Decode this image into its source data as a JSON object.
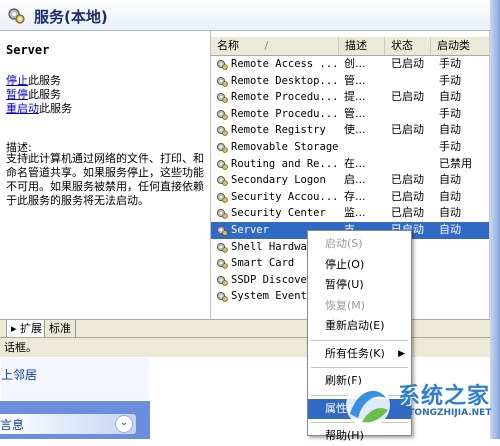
{
  "window": {
    "title": "服务(本地)",
    "icon": "gears-icon"
  },
  "left": {
    "service_name": "Server",
    "actions": [
      {
        "link": "停止",
        "suffix": "此服务"
      },
      {
        "link": "暂停",
        "suffix": "此服务"
      },
      {
        "link": "重启动",
        "suffix": "此服务"
      }
    ],
    "desc_title": "描述:",
    "desc_body": "支持此计算机通过网络的文件、打印、和命名管道共享。如果服务停止，这些功能不可用。如果服务被禁用，任何直接依赖于此服务的服务将无法启动。"
  },
  "list": {
    "columns": [
      "名称",
      "描述",
      "状态",
      "启动类"
    ],
    "rows": [
      {
        "name": "Remote Access ...",
        "desc": "创...",
        "status": "已启动",
        "start": "手动"
      },
      {
        "name": "Remote Desktop...",
        "desc": "管...",
        "status": "",
        "start": "手动"
      },
      {
        "name": "Remote Procedu...",
        "desc": "提...",
        "status": "已启动",
        "start": "自动"
      },
      {
        "name": "Remote Procedu...",
        "desc": "管...",
        "status": "",
        "start": "手动"
      },
      {
        "name": "Remote Registry",
        "desc": "使...",
        "status": "已启动",
        "start": "自动"
      },
      {
        "name": "Removable Storage",
        "desc": "",
        "status": "",
        "start": "手动"
      },
      {
        "name": "Routing and Re...",
        "desc": "在...",
        "status": "",
        "start": "已禁用"
      },
      {
        "name": "Secondary Logon",
        "desc": "启...",
        "status": "已启动",
        "start": "自动"
      },
      {
        "name": "Security Accou...",
        "desc": "存...",
        "status": "已启动",
        "start": "自动"
      },
      {
        "name": "Security Center",
        "desc": "监...",
        "status": "已启动",
        "start": "自动"
      },
      {
        "name": "Server",
        "desc": "支...",
        "status": "已启动",
        "start": "自动",
        "selected": true
      },
      {
        "name": "Shell Hardware...",
        "desc": "",
        "status": "",
        "start": ""
      },
      {
        "name": "Smart Card",
        "desc": "",
        "status": "",
        "start": ""
      },
      {
        "name": "SSDP Discover...",
        "desc": "",
        "status": "",
        "start": ""
      },
      {
        "name": "System Event ...",
        "desc": "",
        "status": "",
        "start": ""
      }
    ]
  },
  "tabs": [
    "扩展",
    "标准"
  ],
  "status_text": "话框。",
  "taskpane": {
    "link": "上邻居",
    "group": "言息"
  },
  "context_menu": [
    {
      "label": "启动(S)",
      "disabled": true
    },
    {
      "label": "停止(O)"
    },
    {
      "label": "暂停(U)"
    },
    {
      "label": "恢复(M)",
      "disabled": true
    },
    {
      "label": "重新启动(E)"
    },
    {
      "separator": true
    },
    {
      "label": "所有任务(K)",
      "submenu": true
    },
    {
      "separator": true
    },
    {
      "label": "刷新(F)"
    },
    {
      "separator": true
    },
    {
      "label": "属性(R)",
      "highlighted": true
    },
    {
      "separator": true
    },
    {
      "label": "帮助(H)"
    }
  ],
  "watermark": {
    "name": "系统之家",
    "url": "XITONGZHIJIA.NET"
  },
  "colors": {
    "selection": "#316ac5",
    "link": "#0000cc",
    "title": "#1b2e6b"
  }
}
